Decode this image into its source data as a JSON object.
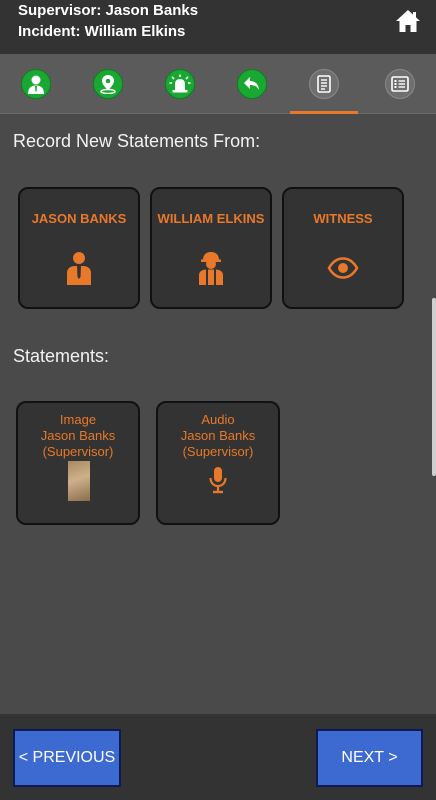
{
  "header": {
    "supervisor": "Supervisor: Jason Banks",
    "incident": "Incident: William Elkins"
  },
  "tabs": [
    {
      "icon": "person-icon",
      "state": "done"
    },
    {
      "icon": "location-pin-icon",
      "state": "done"
    },
    {
      "icon": "siren-icon",
      "state": "done"
    },
    {
      "icon": "reply-icon",
      "state": "done"
    },
    {
      "icon": "document-icon",
      "state": "active"
    },
    {
      "icon": "checklist-icon",
      "state": "pending"
    }
  ],
  "record_section": {
    "title": "Record New Statements From:",
    "people": [
      {
        "label": "JASON BANKS",
        "icon": "supervisor-icon"
      },
      {
        "label": "WILLIAM ELKINS",
        "icon": "worker-icon"
      },
      {
        "label": "WITNESS",
        "icon": "eye-icon"
      }
    ]
  },
  "statements_section": {
    "title": "Statements:",
    "items": [
      {
        "type": "Image",
        "name": "Jason Banks",
        "role": "(Supervisor)",
        "icon": "image-thumbnail"
      },
      {
        "type": "Audio",
        "name": "Jason Banks",
        "role": "(Supervisor)",
        "icon": "microphone-icon"
      }
    ]
  },
  "footer": {
    "previous_label": "< PREVIOUS",
    "next_label": "NEXT >"
  },
  "colors": {
    "accent": "#e8782a",
    "green": "#19a832",
    "button_blue": "#3d6ad1",
    "card_bg": "#333333",
    "page_bg": "#4a4a4a"
  }
}
